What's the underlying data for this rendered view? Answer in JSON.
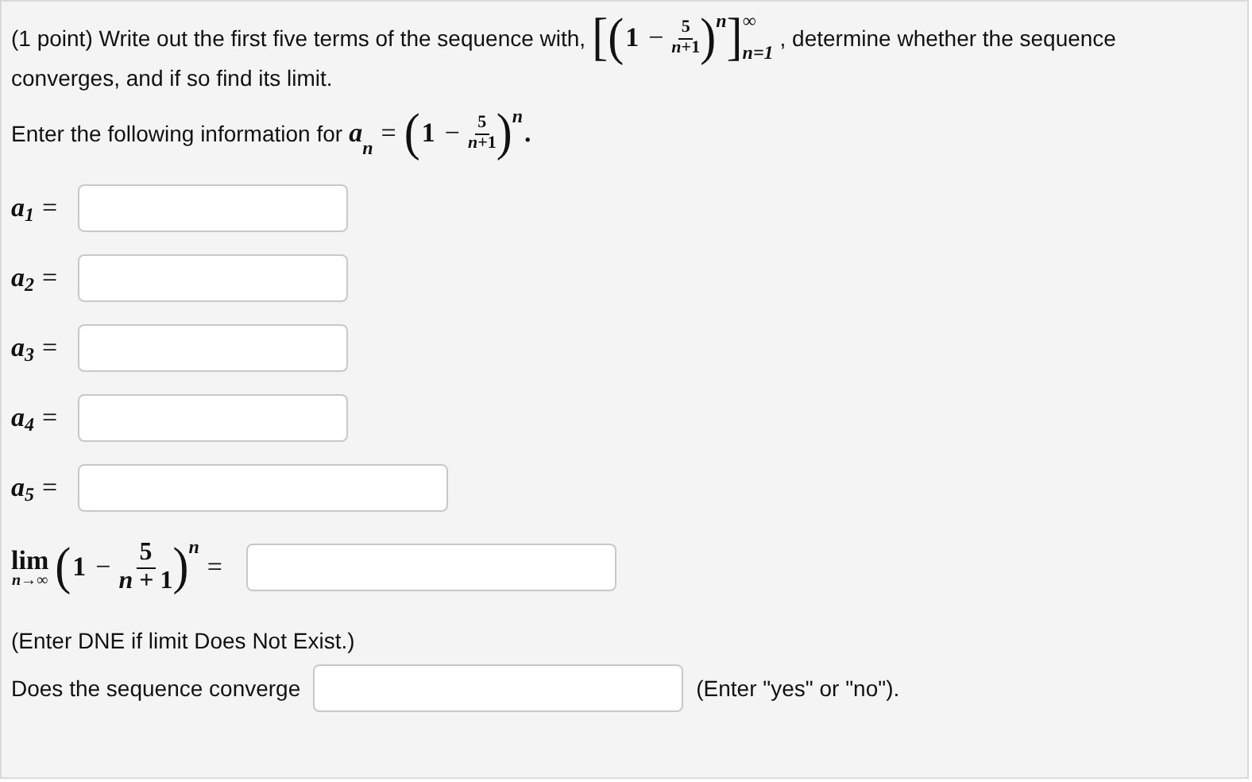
{
  "intro": {
    "before": "(1 point) Write out the first five terms of the sequence with,",
    "formula": [
      {
        "kind": "big",
        "text": "["
      },
      {
        "kind": "big",
        "text": "("
      },
      {
        "kind": "num",
        "text": "1"
      },
      {
        "kind": "op",
        "text": "−"
      },
      {
        "kind": "frac",
        "num": "5",
        "den": "*n*+1",
        "small": true
      },
      {
        "kind": "big",
        "text": ")"
      },
      {
        "kind": "scripts",
        "sup": "n"
      },
      {
        "kind": "big",
        "text": "]"
      },
      {
        "kind": "scripts",
        "sup": "∞",
        "sub": "n=1"
      }
    ],
    "after": ", determine whether the sequence",
    "line2": "converges, and if so find its limit."
  },
  "prompt": {
    "text": "Enter the following information for",
    "formula": [
      {
        "kind": "var",
        "text": "a"
      },
      {
        "kind": "scripts",
        "sub": "n"
      },
      {
        "kind": "op",
        "text": "="
      },
      {
        "kind": "big",
        "text": "("
      },
      {
        "kind": "num",
        "text": "1"
      },
      {
        "kind": "op",
        "text": "−"
      },
      {
        "kind": "frac",
        "num": "5",
        "den": "*n*+1",
        "small": true
      },
      {
        "kind": "big",
        "text": ")"
      },
      {
        "kind": "scripts",
        "sup": "n"
      },
      {
        "kind": "num",
        "text": "."
      }
    ]
  },
  "terms": [
    {
      "label": [
        {
          "kind": "var",
          "text": "a"
        },
        {
          "kind": "scripts",
          "sub": "1"
        },
        {
          "kind": "op",
          "text": "="
        }
      ]
    },
    {
      "label": [
        {
          "kind": "var",
          "text": "a"
        },
        {
          "kind": "scripts",
          "sub": "2"
        },
        {
          "kind": "op",
          "text": "="
        }
      ]
    },
    {
      "label": [
        {
          "kind": "var",
          "text": "a"
        },
        {
          "kind": "scripts",
          "sub": "3"
        },
        {
          "kind": "op",
          "text": "="
        }
      ]
    },
    {
      "label": [
        {
          "kind": "var",
          "text": "a"
        },
        {
          "kind": "scripts",
          "sub": "4"
        },
        {
          "kind": "op",
          "text": "="
        }
      ]
    },
    {
      "label": [
        {
          "kind": "var",
          "text": "a"
        },
        {
          "kind": "scripts",
          "sub": "5"
        },
        {
          "kind": "op",
          "text": "="
        }
      ]
    }
  ],
  "limit": {
    "label": [
      {
        "kind": "lim",
        "text": "lim",
        "under": "n→∞"
      },
      {
        "kind": "big",
        "text": "("
      },
      {
        "kind": "num",
        "text": "1"
      },
      {
        "kind": "op",
        "text": "−"
      },
      {
        "kind": "frac",
        "num": "5",
        "den": "*n* + 1",
        "small": false
      },
      {
        "kind": "big",
        "text": ")"
      },
      {
        "kind": "scripts",
        "sup": "n"
      },
      {
        "kind": "op",
        "text": "="
      }
    ],
    "note": "(Enter DNE if limit Does Not Exist.)"
  },
  "converge": {
    "label": "Does the sequence converge",
    "hint": "(Enter \"yes\" or \"no\")."
  }
}
